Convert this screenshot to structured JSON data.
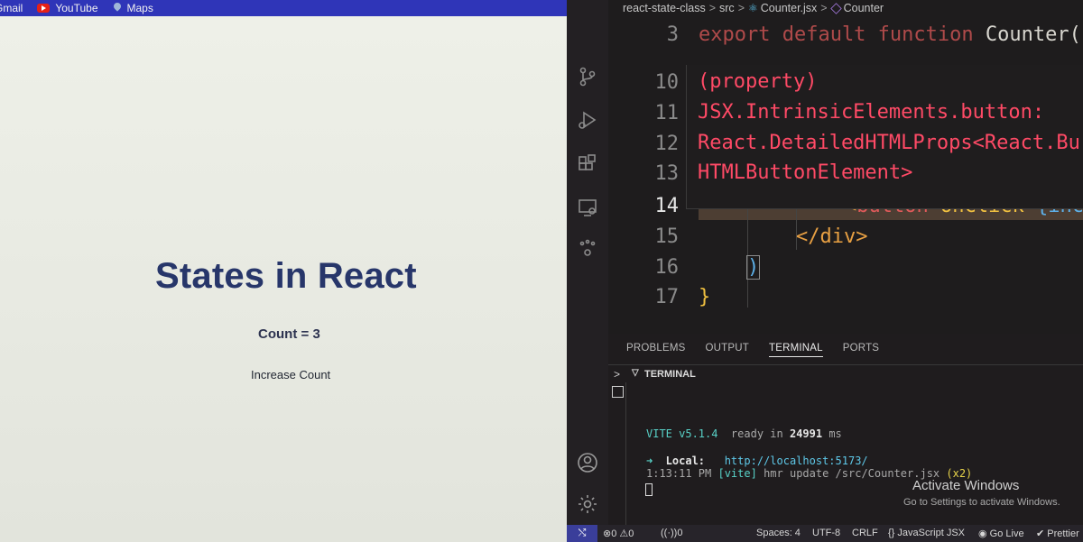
{
  "browser": {
    "bookmarks": [
      {
        "label": "Gmail",
        "icon": "gmail-icon"
      },
      {
        "label": "YouTube",
        "icon": "youtube-icon"
      },
      {
        "label": "Maps",
        "icon": "maps-icon"
      }
    ],
    "page": {
      "title": "States in React",
      "count_label": "Count",
      "count_eq": " = ",
      "count_value": "3",
      "button_label": "Increase Count"
    }
  },
  "editor": {
    "breadcrumbs": [
      "react-state-class",
      "src",
      "Counter.jsx",
      "Counter"
    ],
    "lines": {
      "l3": "3",
      "l10": "10",
      "l11": "11",
      "l12": "12",
      "l13": "13",
      "l14": "14",
      "l15": "15",
      "l16": "16",
      "l17": "17"
    },
    "code": {
      "line3_kw": "export default function",
      "line3_fn": " Counter(",
      "line14_lt": "<",
      "line14_tag": "button",
      "line14_attr": " onClick",
      "line14_rest": "={inc",
      "line15": "</div>",
      "line16": ")",
      "line17": "}"
    },
    "hover": {
      "p1": "(property)",
      "p2": "JSX.IntrinsicElements.button:",
      "p3": "React.DetailedHTMLProps<React.Bu",
      "p4": "HTMLButtonElement>"
    }
  },
  "panel": {
    "tabs": [
      "PROBLEMS",
      "OUTPUT",
      "TERMINAL",
      "PORTS"
    ],
    "active_tab": "TERMINAL",
    "terminal_title": "TERMINAL",
    "vite_name": "VITE",
    "vite_version": " v5.1.4",
    "ready_text": "  ready in ",
    "ready_ms": "24991",
    "ready_unit": " ms",
    "local_arrow": "➜",
    "local_label": "  Local:",
    "local_url": "   http://localhost:5173/",
    "hmr_time": "1:13:11 PM ",
    "hmr_tag": "[vite]",
    "hmr_text": " hmr update ",
    "hmr_file": "/src/Counter.jsx",
    "hmr_count": " (x2)",
    "activate_title": "Activate Windows",
    "activate_sub": "Go to Settings to activate Windows."
  },
  "statusbar": {
    "errors": "0",
    "warnings": "0",
    "ports": "0",
    "spaces": "Spaces: 4",
    "encoding": "UTF-8",
    "eol": "CRLF",
    "language": "JavaScript JSX",
    "golive": "Go Live",
    "prettier": "Prettier"
  },
  "colors": {
    "bookmark_bar": "#2f35b8",
    "page_title": "#27366a",
    "editor_bg": "#1e1c1d",
    "keyword": "#e05a5a",
    "tag": "#e8a043",
    "terminal_cyan": "#58d2c8"
  }
}
